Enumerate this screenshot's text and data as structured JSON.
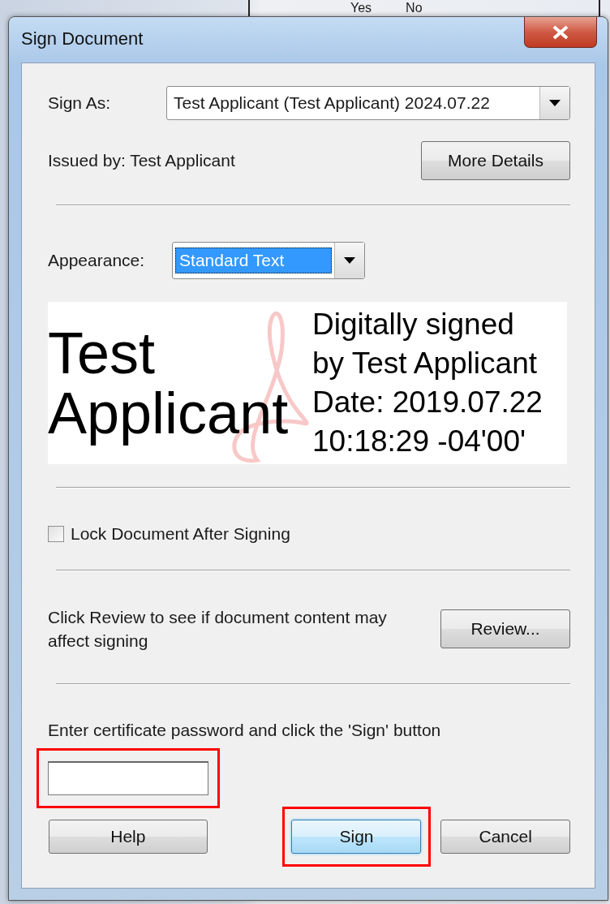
{
  "background": {
    "header_texts": [
      "Yes",
      "No"
    ]
  },
  "window": {
    "title": "Sign Document"
  },
  "sign_as": {
    "label": "Sign As:",
    "value": "Test Applicant (Test Applicant) 2024.07.22"
  },
  "issued_by": "Issued by: Test Applicant",
  "more_details_button": "More Details",
  "appearance": {
    "label": "Appearance:",
    "value": "Standard Text",
    "focused": true
  },
  "signature_preview": {
    "name_lines": [
      "Test",
      "Applicant"
    ],
    "detail_lines": [
      "Digitally signed",
      "by Test Applicant",
      "Date: 2019.07.22",
      "10:18:29 -04'00'"
    ]
  },
  "lock_document": {
    "label": "Lock Document After Signing",
    "checked": false
  },
  "review": {
    "text": "Click Review to see if document content may affect signing",
    "button": "Review..."
  },
  "password": {
    "label": "Enter certificate password and click the 'Sign' button",
    "highlighted": true
  },
  "buttons": [
    {
      "label": "Help",
      "kind": "normal",
      "highlighted": false
    },
    {
      "label": "Sign",
      "kind": "default",
      "highlighted": true
    },
    {
      "label": "Cancel",
      "kind": "normal",
      "highlighted": false
    }
  ]
}
